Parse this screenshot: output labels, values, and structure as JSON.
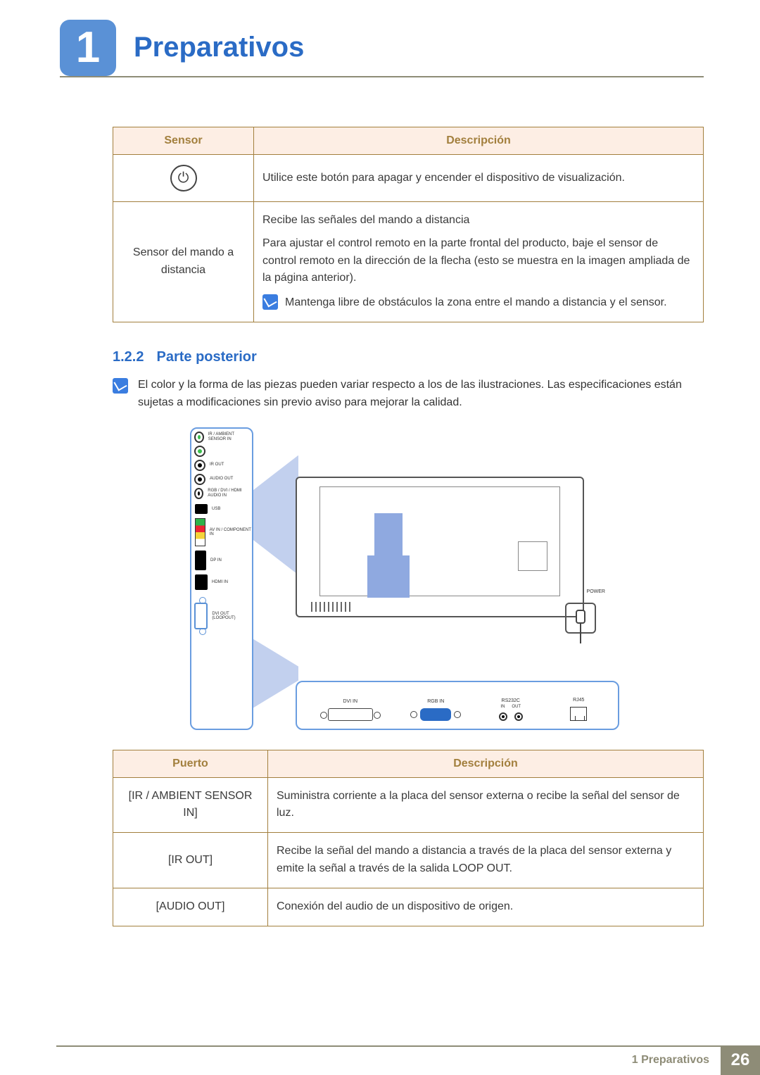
{
  "chapter": {
    "number": "1",
    "title": "Preparativos"
  },
  "sensor_table": {
    "headers": {
      "sensor": "Sensor",
      "desc": "Descripción"
    },
    "row1": {
      "desc": "Utilice este botón para apagar y encender el dispositivo de visualización."
    },
    "row2": {
      "label": "Sensor del mando a distancia",
      "p1": "Recibe las señales del mando a distancia",
      "p2": "Para ajustar el control remoto en la parte frontal del producto, baje el sensor de control remoto en la dirección de la flecha (esto se muestra en la imagen ampliada de la página anterior).",
      "note": "Mantenga libre de obstáculos la zona entre el mando a distancia y el sensor."
    }
  },
  "section": {
    "num": "1.2.2",
    "title": "Parte posterior"
  },
  "top_note": "El color y la forma de las piezas pueden variar respecto a los de las ilustraciones. Las especificaciones están sujetas a modificaciones sin previo aviso para mejorar la calidad.",
  "figure": {
    "vports": {
      "ir_ambient": "IR / AMBIENT SENSOR IN",
      "ir_out": "IR OUT",
      "audio_out": "AUDIO OUT",
      "rgb_dvi_hdmi_audio_in": "RGB / DVI / HDMI AUDIO IN",
      "usb": "USB",
      "av_component": "AV IN / COMPONENT IN",
      "dp_in": "DP IN",
      "hdmi_in": "HDMI IN",
      "dvi_out": "DVI OUT (LOOPOUT)"
    },
    "hports": {
      "dvi_in": "DVI IN",
      "rgb_in": "RGB IN",
      "rs232c": "RS232C",
      "rs_in": "IN",
      "rs_out": "OUT",
      "rj45": "RJ45"
    },
    "power": "POWER"
  },
  "port_table": {
    "headers": {
      "port": "Puerto",
      "desc": "Descripción"
    },
    "rows": [
      {
        "port": "[IR / AMBIENT SENSOR IN]",
        "desc": "Suministra corriente a la placa del sensor externa o recibe la señal del sensor de luz."
      },
      {
        "port": "[IR OUT]",
        "desc": "Recibe la señal del mando a distancia a través de la placa del sensor externa y emite la señal a través de la salida LOOP OUT."
      },
      {
        "port": "[AUDIO OUT]",
        "desc": "Conexión del audio de un dispositivo de origen."
      }
    ]
  },
  "footer": {
    "section": "1 Preparativos",
    "page": "26"
  }
}
